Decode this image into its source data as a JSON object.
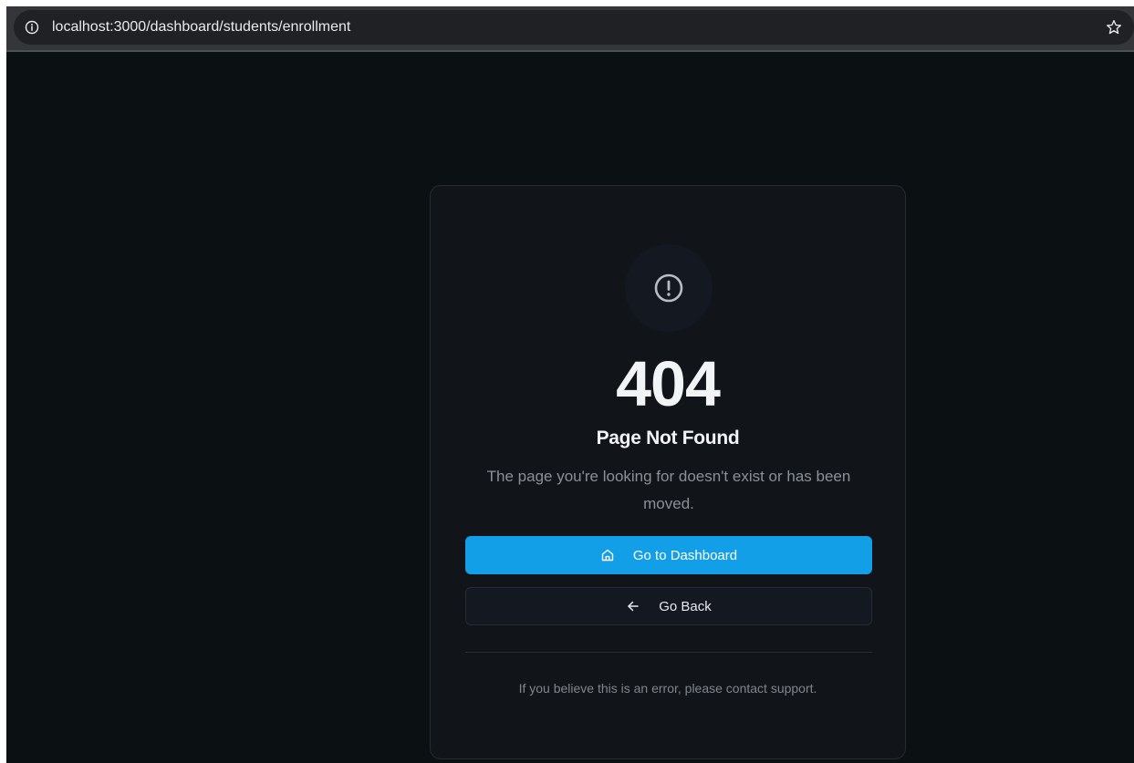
{
  "browser": {
    "url": "localhost:3000/dashboard/students/enrollment",
    "info_icon": "info-circle-icon",
    "bookmark_icon": "star-outline-icon"
  },
  "error_page": {
    "icon": "alert-circle-icon",
    "code": "404",
    "title": "Page Not Found",
    "description": "The page you're looking for doesn't exist or has been moved.",
    "primary_button": {
      "label": "Go to Dashboard",
      "icon": "home-icon"
    },
    "secondary_button": {
      "label": "Go Back",
      "icon": "arrow-left-icon"
    },
    "footer_note": "If you believe this is an error, please contact support."
  },
  "colors": {
    "page_background": "#0b1112",
    "card_background": "#111519",
    "accent": "#139fe8",
    "text_primary": "#f2f3f5",
    "text_muted": "#8b9098"
  }
}
